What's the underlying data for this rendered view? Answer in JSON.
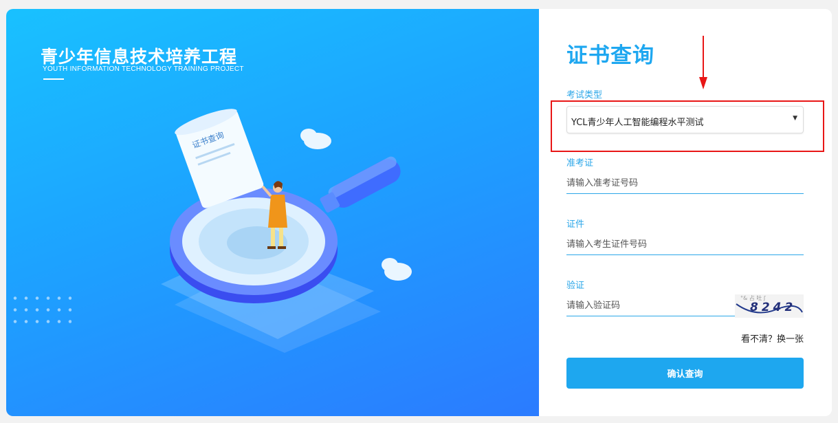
{
  "hero": {
    "title": "青少年信息技术培养工程",
    "subtitle": "YOUTH INFORMATION TECHNOLOGY TRAINING PROJECT",
    "scroll_text": "证书查询"
  },
  "form": {
    "title": "证书查询",
    "exam_type": {
      "label": "考试类型",
      "value": "YCL青少年人工智能编程水平测试"
    },
    "admission": {
      "label": "准考证",
      "placeholder": "请输入准考证号码"
    },
    "id_doc": {
      "label": "证件",
      "placeholder": "请输入考生证件号码"
    },
    "captcha": {
      "label": "验证",
      "placeholder": "请输入验证码",
      "code": "8242"
    },
    "refresh_text": "看不清？换一张",
    "submit_label": "确认查询"
  },
  "colors": {
    "accent": "#1ea7ef",
    "annotation": "#e81616"
  }
}
